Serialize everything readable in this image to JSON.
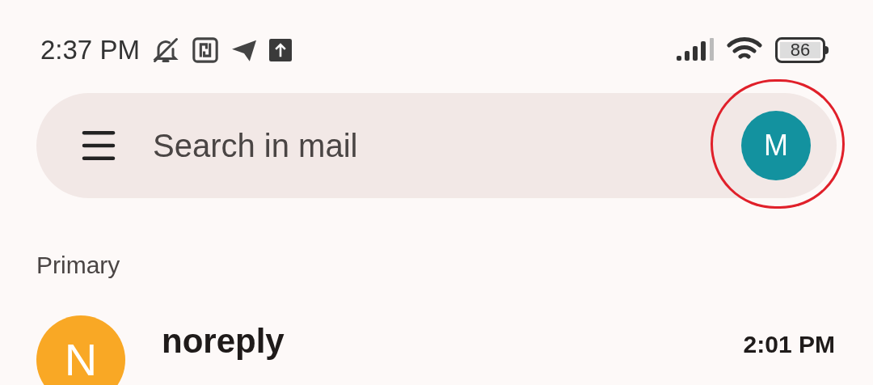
{
  "status_bar": {
    "time": "2:37 PM",
    "battery": "86"
  },
  "search": {
    "placeholder": "Search in mail"
  },
  "account": {
    "initial": "M",
    "color": "#13929f",
    "highlighted": true
  },
  "section": {
    "label": "Primary"
  },
  "emails": [
    {
      "sender": "noreply",
      "time": "2:01 PM",
      "initial": "N",
      "color": "#f9a825",
      "unread": true
    }
  ]
}
